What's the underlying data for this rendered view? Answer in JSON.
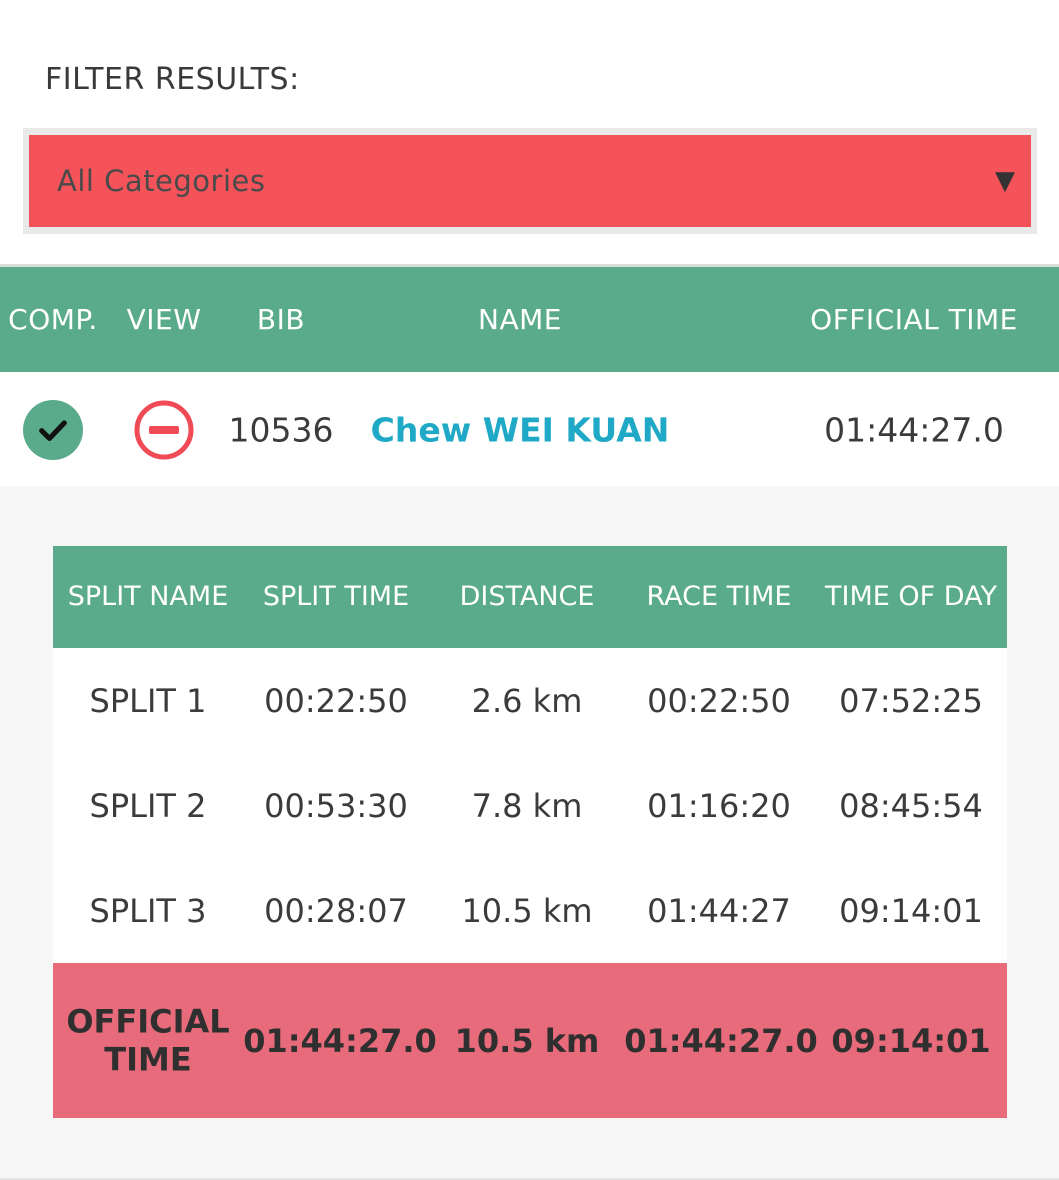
{
  "filter": {
    "label": "FILTER RESULTS:",
    "selected": "All Categories",
    "caret": "▼"
  },
  "colors": {
    "accent_green": "#5aab8c",
    "select_red": "#f5535a",
    "official_row": "#e76b7a",
    "name_link": "#1fa9c6"
  },
  "results": {
    "columns": [
      "COMP.",
      "VIEW",
      "BIB",
      "NAME",
      "OFFICIAL TIME"
    ],
    "row": {
      "completed_icon": "check-icon",
      "view_icon": "minus-circle-icon",
      "bib": "10536",
      "name": "Chew WEI KUAN",
      "official_time": "01:44:27.0"
    }
  },
  "splits": {
    "columns": [
      "SPLIT NAME",
      "SPLIT TIME",
      "DISTANCE",
      "RACE TIME",
      "TIME OF DAY"
    ],
    "rows": [
      {
        "name": "SPLIT 1",
        "split_time": "00:22:50",
        "distance": "2.6 km",
        "race_time": "00:22:50",
        "time_of_day": "07:52:25"
      },
      {
        "name": "SPLIT 2",
        "split_time": "00:53:30",
        "distance": "7.8 km",
        "race_time": "01:16:20",
        "time_of_day": "08:45:54"
      },
      {
        "name": "SPLIT 3",
        "split_time": "00:28:07",
        "distance": "10.5 km",
        "race_time": "01:44:27",
        "time_of_day": "09:14:01"
      }
    ],
    "official": {
      "name": "OFFICIAL TIME",
      "split_time": "01:44:27.0",
      "distance": "10.5 km",
      "race_time": "01:44:27.0",
      "time_of_day": "09:14:01"
    }
  }
}
